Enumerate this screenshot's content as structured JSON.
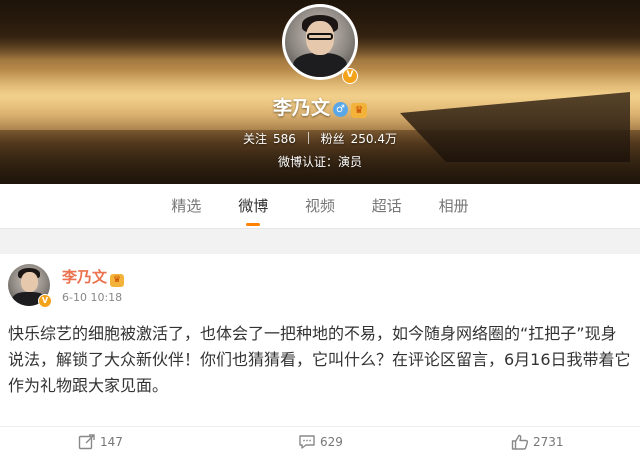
{
  "profile": {
    "name": "李乃文",
    "gender_icon": "male-icon",
    "verified_icon": "v-badge-icon",
    "follow_label": "关注",
    "follow_count": "586",
    "fans_label": "粉丝",
    "fans_count": "250.4万",
    "verification_text": "微博认证：演员"
  },
  "tabs": [
    {
      "label": "精选",
      "active": false
    },
    {
      "label": "微博",
      "active": true
    },
    {
      "label": "视频",
      "active": false
    },
    {
      "label": "超话",
      "active": false
    },
    {
      "label": "相册",
      "active": false
    }
  ],
  "post": {
    "author": "李乃文",
    "time": "6-10 10:18",
    "text": "快乐综艺的细胞被激活了，也体会了一把种地的不易，如今随身网络圈的“扛把子”现身说法，解锁了大众新伙伴！你们也猜猜看，它叫什么？在评论区留言，6月16日我带着它作为礼物跟大家见面。",
    "repost_count": "147",
    "comment_count": "629",
    "like_count": "2731"
  },
  "colors": {
    "accent_orange": "#ff8200",
    "username_orange": "#eb7350",
    "verified_gold": "#f4a21a",
    "gender_blue": "#5aa7e8"
  }
}
